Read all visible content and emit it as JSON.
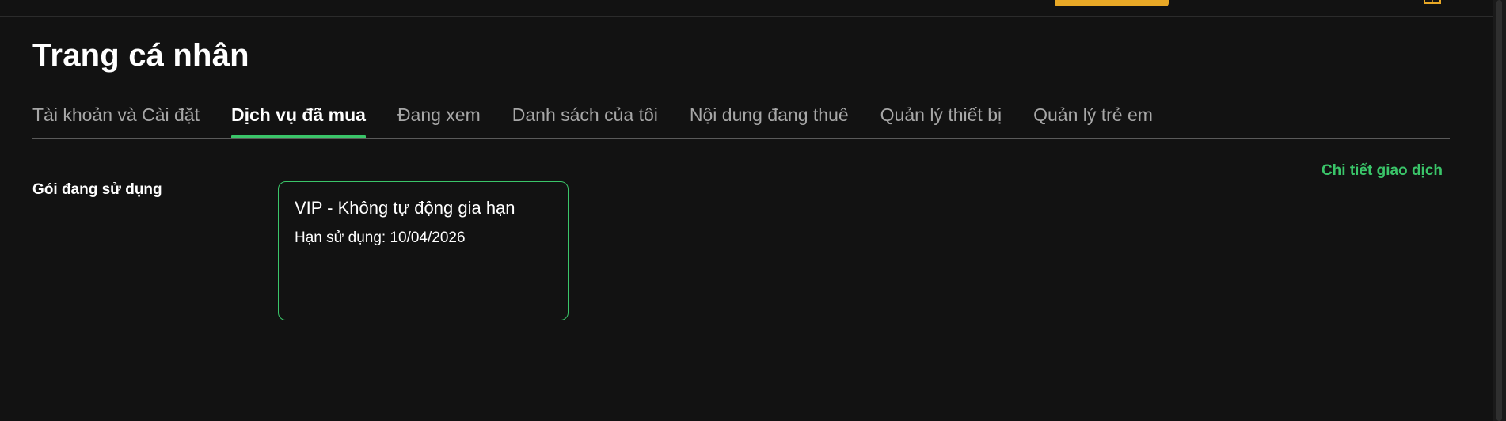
{
  "header": {
    "logo_name": "logo",
    "cta_color": "#e8a826"
  },
  "page": {
    "title": "Trang cá nhân"
  },
  "tabs": [
    {
      "label": "Tài khoản và Cài đặt",
      "active": false
    },
    {
      "label": "Dịch vụ đã mua",
      "active": true
    },
    {
      "label": "Đang xem",
      "active": false
    },
    {
      "label": "Danh sách của tôi",
      "active": false
    },
    {
      "label": "Nội dung đang thuê",
      "active": false
    },
    {
      "label": "Quản lý thiết bị",
      "active": false
    },
    {
      "label": "Quản lý trẻ em",
      "active": false
    }
  ],
  "subscription": {
    "section_label": "Gói đang sử dụng",
    "detail_link": "Chi tiết giao dịch",
    "package_name": "VIP - Không tự động gia hạn",
    "expiry_text": "Hạn sử dụng: 10/04/2026"
  },
  "colors": {
    "background": "#121212",
    "accent": "#3ac569",
    "tab_inactive": "#a7a7a7"
  }
}
